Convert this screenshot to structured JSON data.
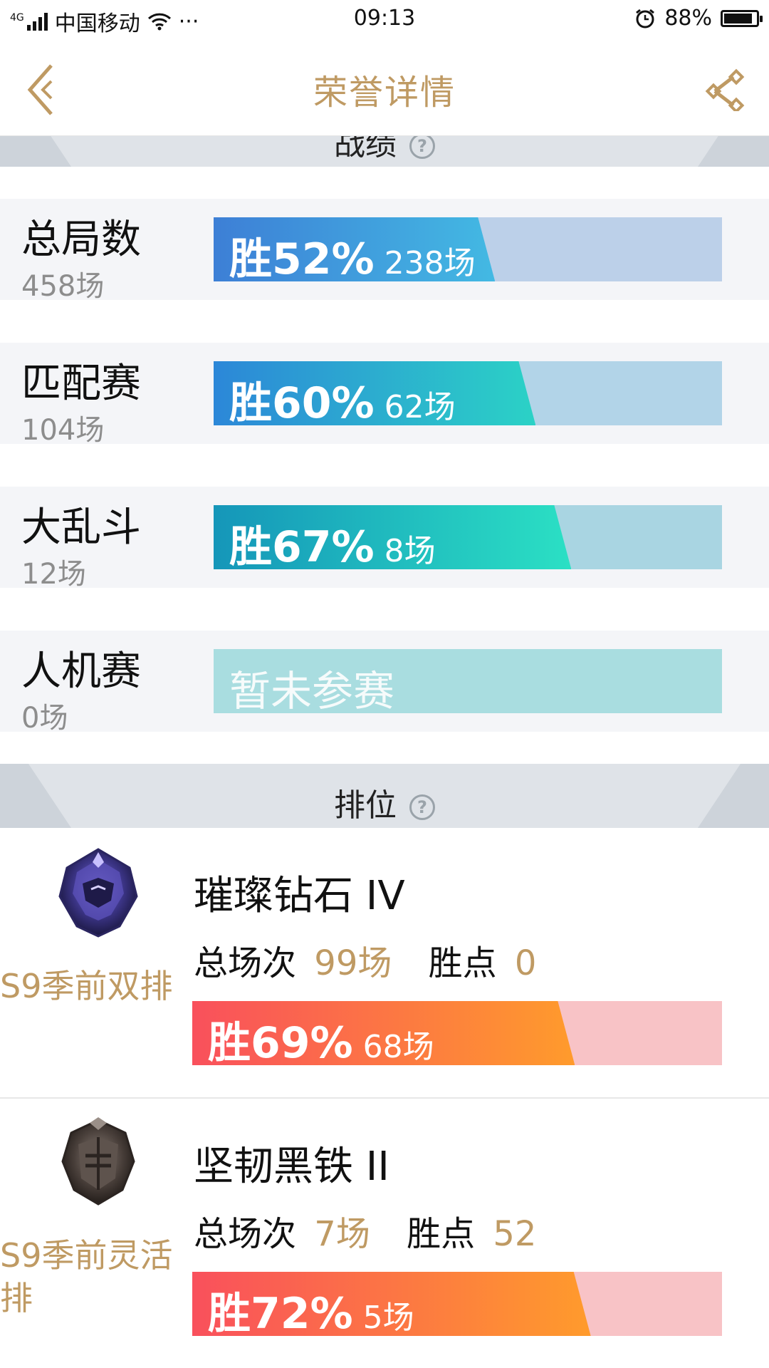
{
  "status_bar": {
    "network": "4G",
    "carrier": "中国移动",
    "more": "···",
    "time": "09:13",
    "battery": "88%",
    "battery_level": 0.88
  },
  "header": {
    "title": "荣誉详情",
    "back_icon": "chevron-left-icon",
    "share_icon": "share-icon"
  },
  "record_section": {
    "label": "战绩"
  },
  "stats": [
    {
      "name": "总局数",
      "count": "458场",
      "win_pct": "胜52%",
      "wins": "238场",
      "fill_fraction": 0.52,
      "gradient": [
        "#3d7fd6",
        "#43b9e3"
      ],
      "track": "#bcd0e9"
    },
    {
      "name": "匹配赛",
      "count": "104场",
      "win_pct": "胜60%",
      "wins": "62场",
      "fill_fraction": 0.6,
      "gradient": [
        "#2c87d8",
        "#2bd2c6"
      ],
      "track": "#b2d4e8"
    },
    {
      "name": "大乱斗",
      "count": "12场",
      "win_pct": "胜67%",
      "wins": "8场",
      "fill_fraction": 0.67,
      "gradient": [
        "#1596b9",
        "#2be0c4"
      ],
      "track": "#a9d5e2"
    },
    {
      "name": "人机赛",
      "count": "0场",
      "empty": "暂未参赛",
      "track": "#a9dde0"
    }
  ],
  "rank_section": {
    "label": "排位"
  },
  "ranks": [
    {
      "mode": "S9季前双排",
      "tier": "璀璨钻石 IV",
      "games_label": "总场次",
      "games": "99场",
      "points_label": "胜点",
      "points": "0",
      "win_pct": "胜69%",
      "wins": "68场",
      "fill_fraction": 0.69
    },
    {
      "mode_line1": "S9季前灵活",
      "mode_line2": "排",
      "tier": "坚韧黑铁 II",
      "games_label": "总场次",
      "games": "7场",
      "points_label": "胜点",
      "points": "52",
      "win_pct": "胜72%",
      "wins": "5场",
      "fill_fraction": 0.72
    }
  ],
  "colors": {
    "accent_gold": "#bf9a63"
  }
}
